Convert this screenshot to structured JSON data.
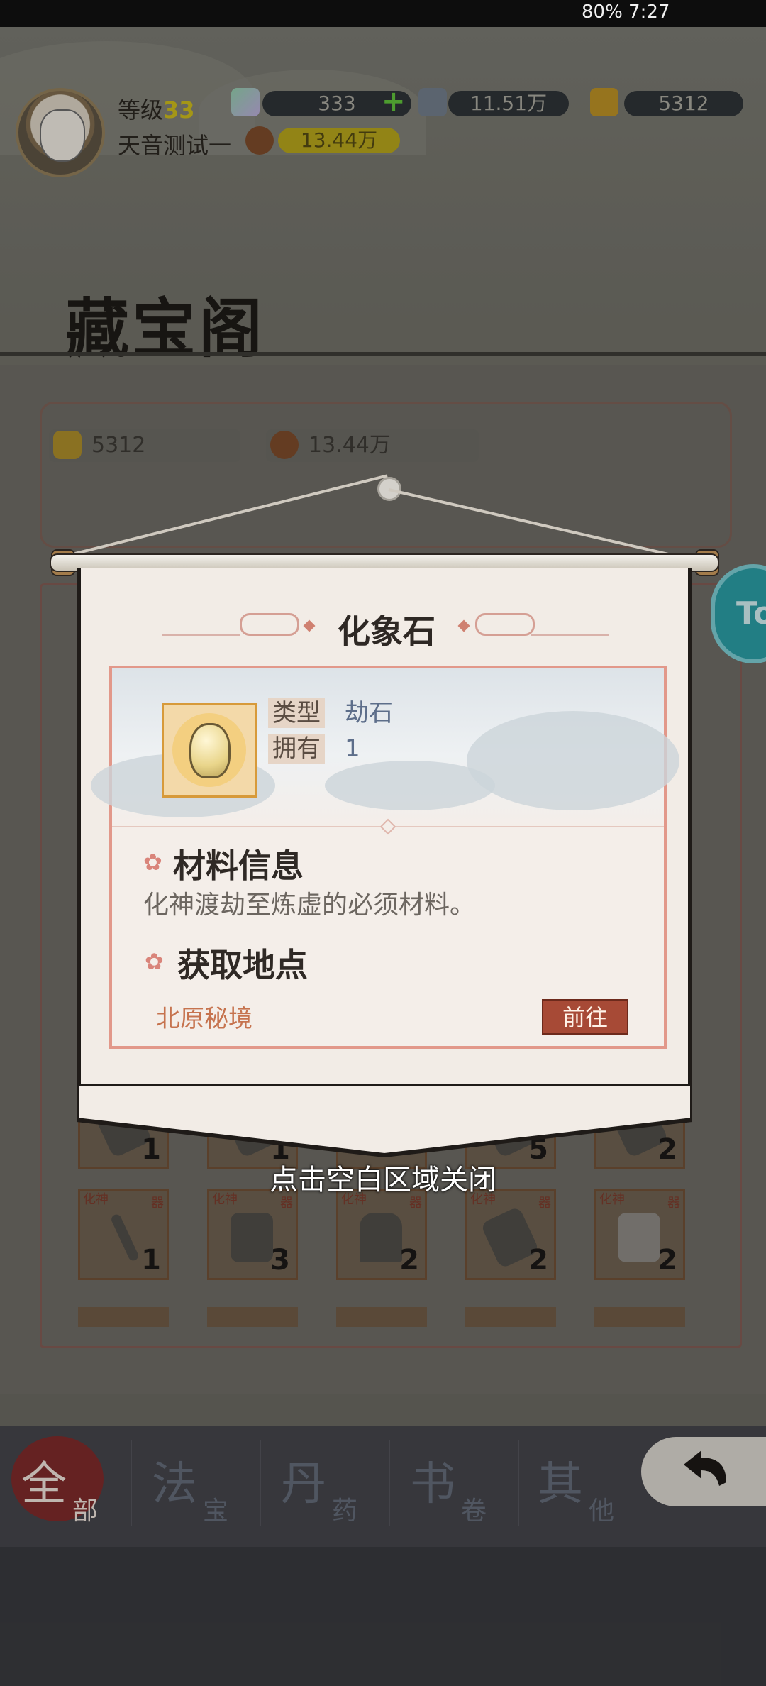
{
  "status_bar": {
    "right_text": "80% 7:27"
  },
  "header": {
    "level_label": "等级",
    "level_value": "33",
    "player_name": "天音测试一",
    "resources": [
      {
        "name": "crystal",
        "value": "333",
        "action": "+"
      },
      {
        "name": "spirit-stone",
        "value": "11.51万"
      },
      {
        "name": "gold",
        "value": "5312"
      },
      {
        "name": "ore",
        "value": "13.44万"
      }
    ]
  },
  "page": {
    "title": "藏宝阁",
    "wallet": [
      {
        "icon": "gold-icon",
        "value": "5312"
      },
      {
        "icon": "ore-icon",
        "value": "13.44万"
      }
    ]
  },
  "grid": {
    "row1_qty": [
      "1",
      "1",
      "",
      "5",
      "2"
    ],
    "row2": [
      {
        "tag_left": "化神",
        "tag_right": "器",
        "qty": "1"
      },
      {
        "tag_left": "化神",
        "tag_right": "器",
        "qty": "3"
      },
      {
        "tag_left": "化神",
        "tag_right": "器",
        "qty": "2"
      },
      {
        "tag_left": "化神",
        "tag_right": "器",
        "qty": "2"
      },
      {
        "tag_left": "化神",
        "tag_right": "器",
        "qty": "2"
      }
    ]
  },
  "side_button": {
    "label": "To"
  },
  "tabs": [
    {
      "big": "全",
      "small": "部",
      "active": true
    },
    {
      "big": "法",
      "small": "宝"
    },
    {
      "big": "丹",
      "small": "药"
    },
    {
      "big": "书",
      "small": "卷"
    },
    {
      "big": "其",
      "small": "他"
    }
  ],
  "modal": {
    "title": "化象石",
    "type_label": "类型",
    "type_value": "劫石",
    "own_label": "拥有",
    "own_value": "1",
    "section_info_title": "材料信息",
    "description": "化神渡劫至炼虚的必须材料。",
    "section_source_title": "获取地点",
    "location": "北原秘境",
    "go_button": "前往",
    "close_hint": "点击空白区域关闭"
  },
  "colors": {
    "accent_red": "#a74a36",
    "location_orange": "#c6734e",
    "paper": "#f2ece6"
  }
}
